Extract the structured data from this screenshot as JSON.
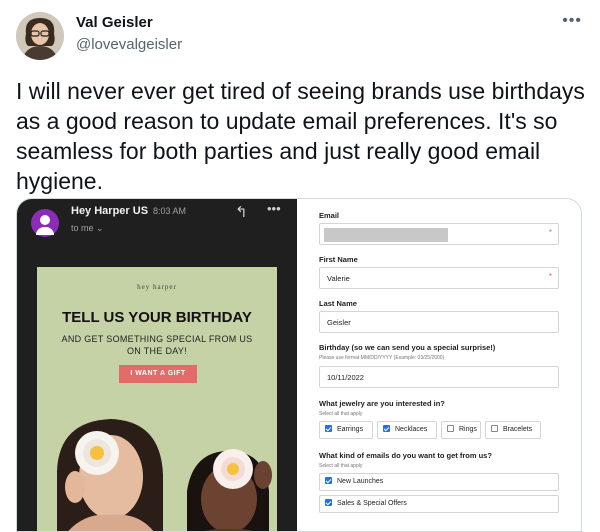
{
  "tweet": {
    "author_name": "Val Geisler",
    "author_handle": "@lovevalgeisler",
    "more_icon": "more-horizontal-icon",
    "text": "I will never ever get tired of seeing brands use birthdays as a good reason to update email preferences. It's so seamless for both parties and just really good email hygiene."
  },
  "email": {
    "sender": "Hey Harper US",
    "time": "8:03 AM",
    "to": "to me ⌄",
    "reply_icon": "reply-icon",
    "more_icon": "more-horizontal-icon",
    "brand": "hey harper",
    "headline": "TELL US YOUR BIRTHDAY",
    "subline": "AND GET SOMETHING SPECIAL FROM US ON THE DAY!",
    "cta": "I WANT A GIFT",
    "colors": {
      "background": "#1f1f1f",
      "card": "#c5d2a6",
      "cta": "#e56a6a",
      "avatar": "#8a2cb8"
    }
  },
  "form": {
    "email_label": "Email",
    "first_name_label": "First Name",
    "first_name_value": "Valerie",
    "last_name_label": "Last Name",
    "last_name_value": "Geisler",
    "birthday_label": "Birthday (so we can send you a special surprise!)",
    "birthday_hint": "Please use format MM/DD/YYYY (Example: 03/25/2000)",
    "birthday_value": "10/11/2022",
    "jewelry_label": "What jewelry are you interested in?",
    "jewelry_hint": "Select all that apply",
    "jewelry_options": [
      {
        "label": "Earrings",
        "checked": true
      },
      {
        "label": "Necklaces",
        "checked": true
      },
      {
        "label": "Rings",
        "checked": false
      },
      {
        "label": "Bracelets",
        "checked": false
      }
    ],
    "emails_label": "What kind of emails do you want to get from us?",
    "emails_hint": "Select all that apply",
    "email_options": [
      {
        "label": "New Launches",
        "checked": true
      },
      {
        "label": "Sales & Special Offers",
        "checked": true
      }
    ],
    "required_mark": "*"
  }
}
